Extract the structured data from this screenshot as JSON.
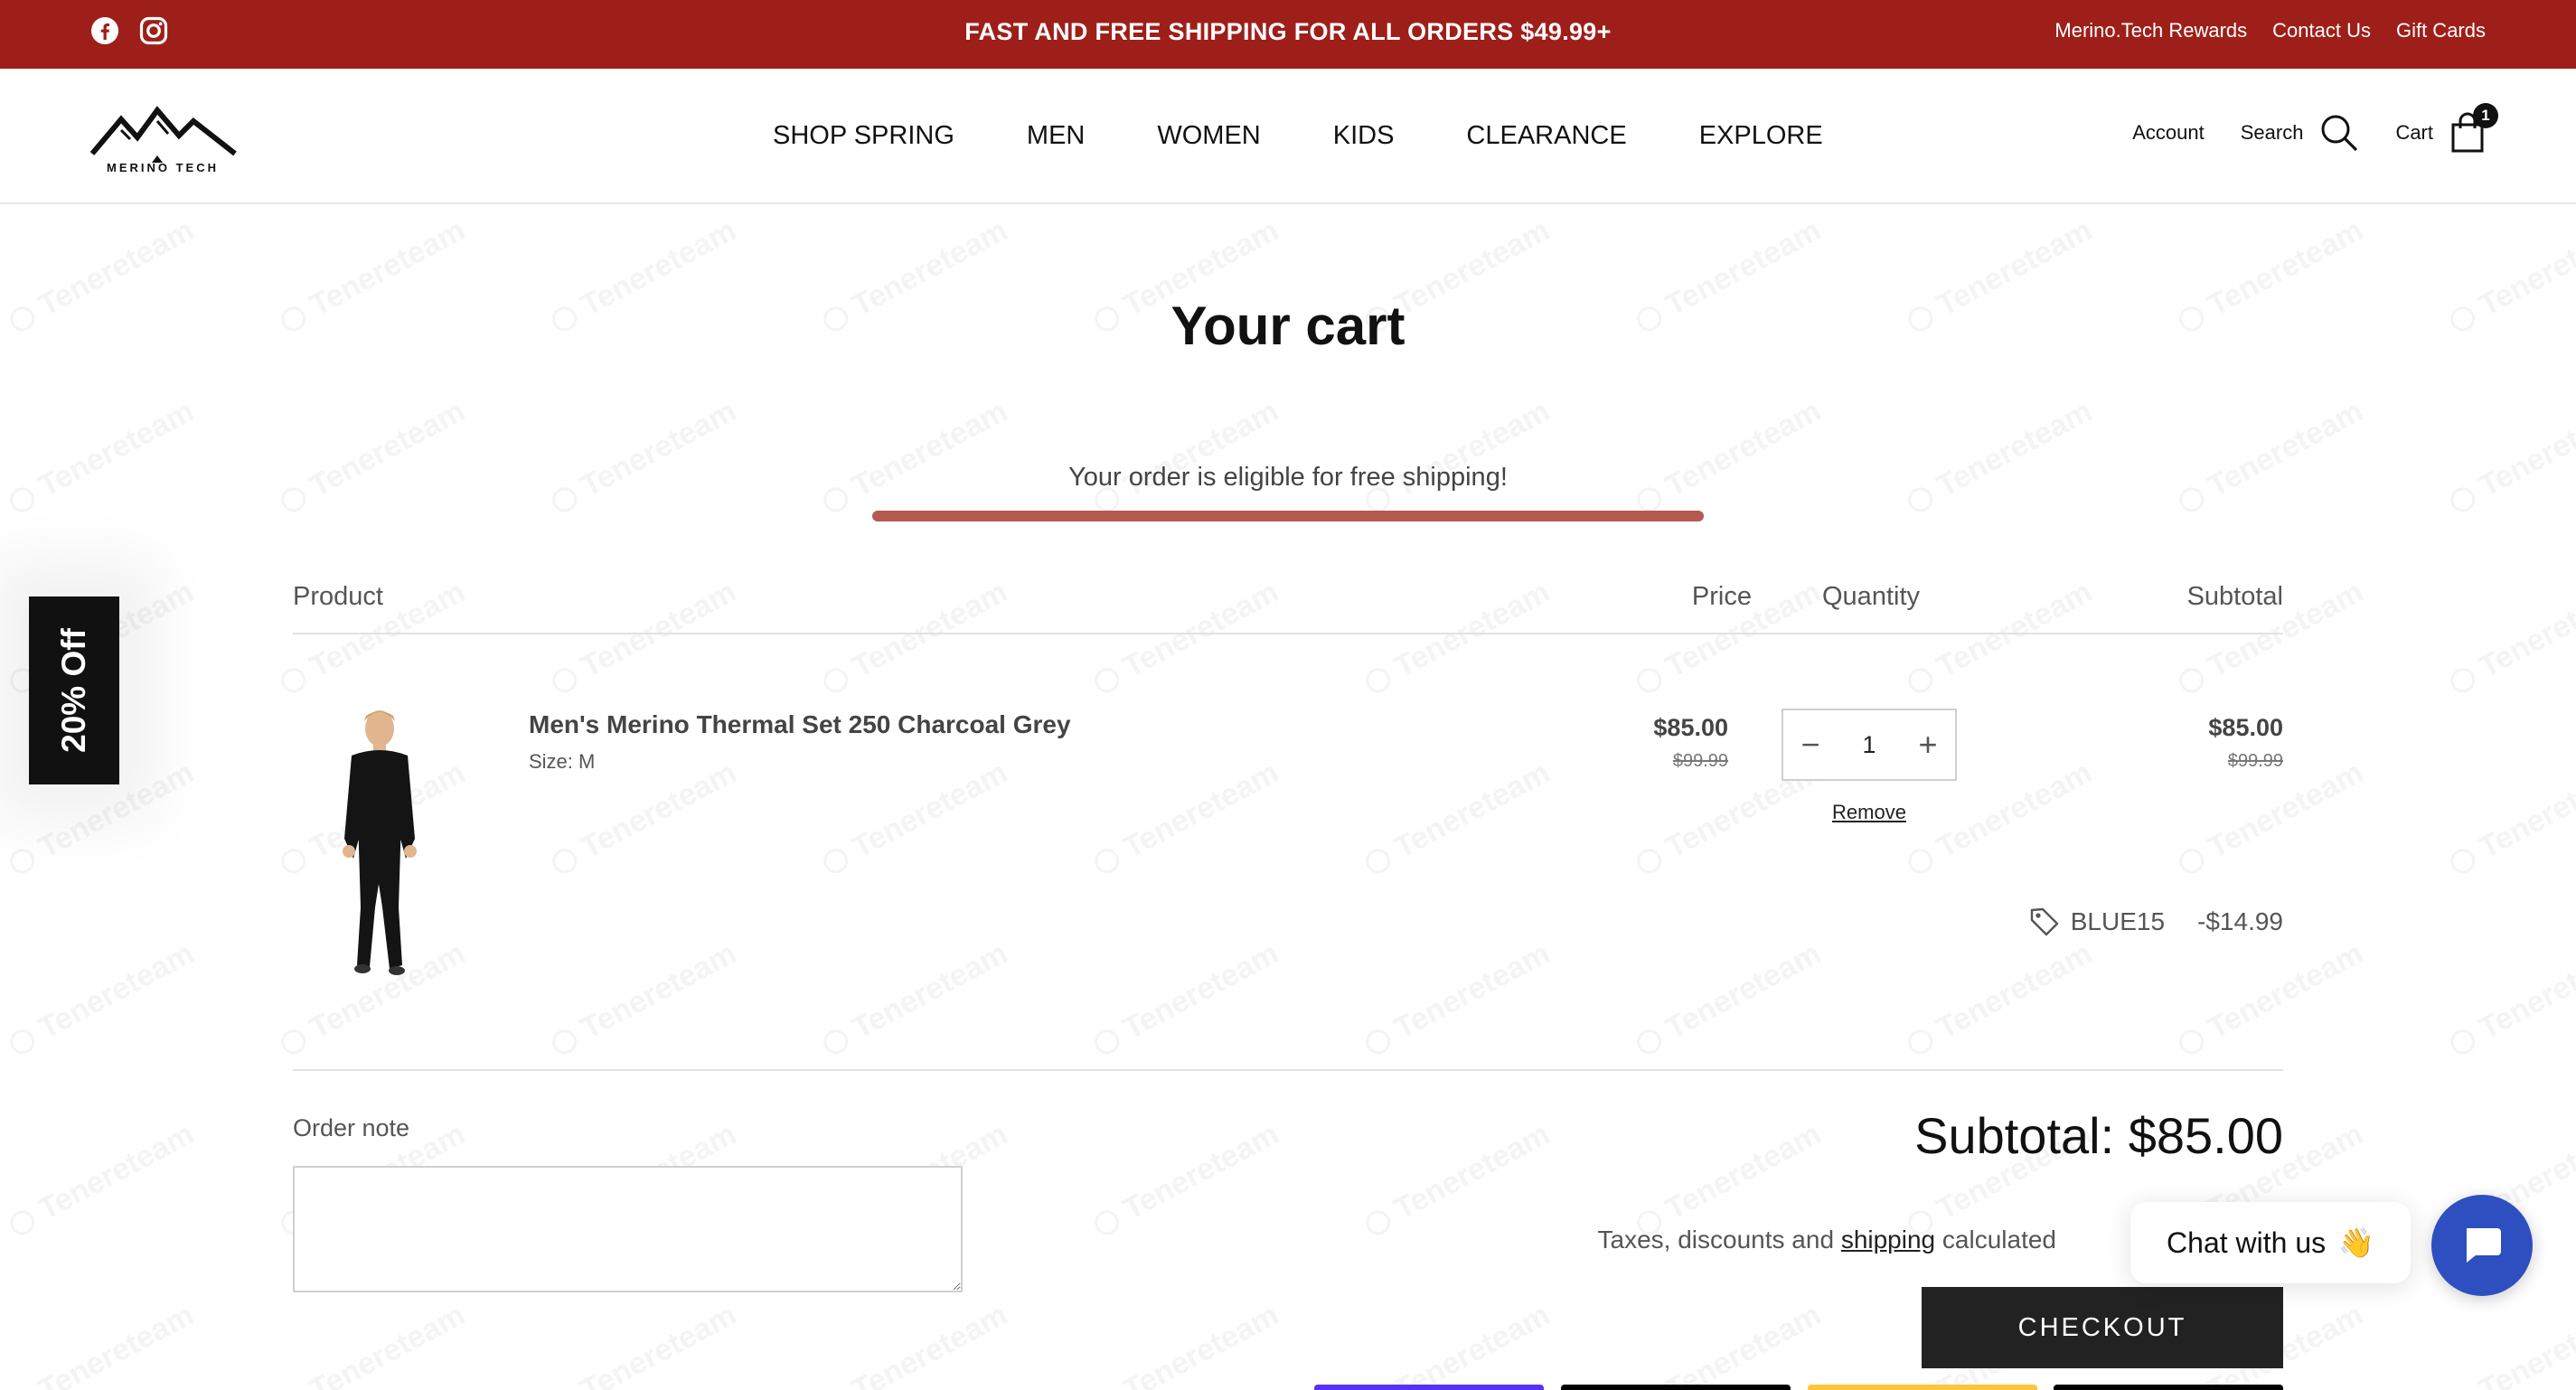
{
  "announcement": {
    "promo": "FAST AND FREE SHIPPING FOR ALL ORDERS $49.99+",
    "social_icons": [
      "facebook-icon",
      "instagram-icon"
    ],
    "links": [
      "Merino.Tech Rewards",
      "Contact Us",
      "Gift Cards"
    ],
    "background": "#9e1f1a"
  },
  "header": {
    "logo_text": "MERINO TECH",
    "nav": [
      "SHOP SPRING",
      "MEN",
      "WOMEN",
      "KIDS",
      "CLEARANCE",
      "EXPLORE"
    ],
    "account_label": "Account",
    "search_label": "Search",
    "cart_label": "Cart",
    "cart_count": "1"
  },
  "side_tab": {
    "label": "20% Off"
  },
  "cart": {
    "title": "Your cart",
    "shipping_message": "Your order is eligible for free shipping!",
    "shipping_progress": 1.0,
    "columns": {
      "product": "Product",
      "price": "Price",
      "quantity": "Quantity",
      "subtotal": "Subtotal"
    },
    "item": {
      "name": "Men's Merino Thermal Set 250 Charcoal Grey",
      "variant": "Size: M",
      "price": "$85.00",
      "compare_price": "$99.99",
      "quantity": "1",
      "remove_label": "Remove",
      "line_total": "$85.00",
      "line_compare": "$99.99",
      "discount_code": "BLUE15",
      "discount_amount": "-$14.99"
    },
    "order_note_label": "Order note",
    "order_note_value": "",
    "subtotal": "Subtotal: $85.00",
    "tax_before": "Taxes, discounts and ",
    "tax_link": "shipping",
    "tax_after": " calculated",
    "checkout_label": "CHECKOUT",
    "payment_colors": [
      "#5a31f4",
      "#000000",
      "#ffc439",
      "#000000"
    ]
  },
  "watermark": {
    "text": "Tenereteam"
  },
  "chat": {
    "label": "Chat with us",
    "emoji": "👋"
  },
  "colors": {
    "accent": "#9e1f1a",
    "progress": "#b6594f",
    "chat": "#2d4fc0"
  }
}
